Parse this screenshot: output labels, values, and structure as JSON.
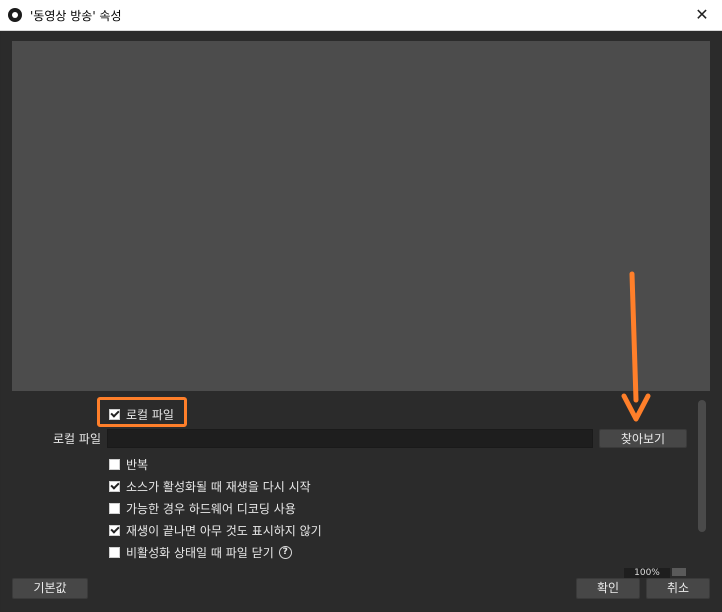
{
  "window": {
    "title": "'동영상 방송' 속성",
    "close_glyph": "✕"
  },
  "settings": {
    "local_file_checkbox": {
      "label": "로컬 파일",
      "checked": true
    },
    "local_file_field": {
      "label": "로컬 파일",
      "value": ""
    },
    "browse_label": "찾아보기",
    "options": [
      {
        "label": "반복",
        "checked": false
      },
      {
        "label": "소스가 활성화될 때 재생을 다시 시작",
        "checked": true
      },
      {
        "label": "가능한 경우 하드웨어 디코딩 사용",
        "checked": false
      },
      {
        "label": "재생이 끝나면 아무 것도 표시하지 않기",
        "checked": true
      },
      {
        "label": "비활성화 상태일 때 파일 닫기",
        "checked": false
      }
    ],
    "help_glyph": "?",
    "speed_percent": "100%"
  },
  "footer": {
    "defaults_label": "기본값",
    "ok_label": "확인",
    "cancel_label": "취소"
  },
  "annotation": {
    "color": "#ff7f2a"
  }
}
